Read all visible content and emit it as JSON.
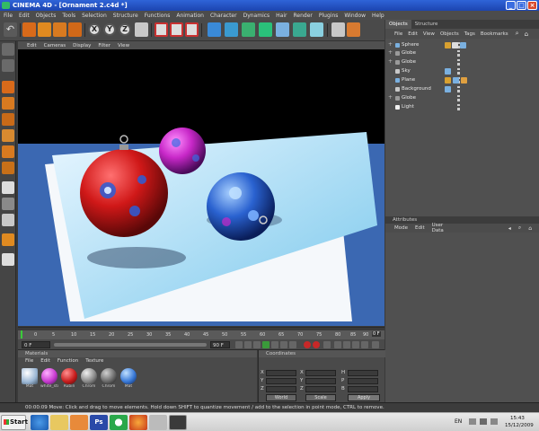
{
  "window": {
    "title": "CINEMA 4D - [Ornament 2.c4d *]"
  },
  "menu": [
    "File",
    "Edit",
    "Objects",
    "Tools",
    "Selection",
    "Structure",
    "Functions",
    "Animation",
    "Character",
    "Dynamics",
    "Hair",
    "Render",
    "Plugins",
    "Window",
    "Help"
  ],
  "toolbar": {
    "axis_x": "X",
    "axis_y": "Y",
    "axis_z": "Z"
  },
  "viewport": {
    "menu": [
      "Edit",
      "Cameras",
      "Display",
      "Filter",
      "View"
    ]
  },
  "timeline": {
    "ticks": [
      "0",
      "5",
      "10",
      "15",
      "20",
      "25",
      "30",
      "35",
      "40",
      "45",
      "50",
      "55",
      "60",
      "65",
      "70",
      "75",
      "80",
      "85",
      "90"
    ],
    "frame_readout": "0 F",
    "start_field": "0 F",
    "end_field": "90 F"
  },
  "materials": {
    "title": "Materials",
    "menu": [
      "File",
      "Edit",
      "Function",
      "Texture"
    ],
    "items": [
      {
        "label": "Mat",
        "color": "#9ab6d4"
      },
      {
        "label": "white_sti",
        "color": "#c83bd0"
      },
      {
        "label": "Rubin",
        "color": "#c81e1e"
      },
      {
        "label": "Chrom",
        "color": "#8a8a8a"
      },
      {
        "label": "Chrom",
        "color": "#6a6a6a"
      },
      {
        "label": "Mat",
        "color": "#3a7ad8"
      }
    ]
  },
  "coordinates": {
    "title": "Coordinates",
    "col_labels": [
      "X",
      "Y",
      "Z"
    ],
    "mid_labels": [
      "X",
      "Y",
      "Z"
    ],
    "right_labels": [
      "H",
      "P",
      "B"
    ],
    "mode_world": "World",
    "mode_scale": "Scale",
    "apply": "Apply"
  },
  "objects_panel": {
    "tabs": [
      "Objects",
      "Structure"
    ],
    "menu": [
      "File",
      "Edit",
      "View",
      "Objects",
      "Tags",
      "Bookmarks"
    ],
    "rows": [
      {
        "name": "Sphere",
        "icon": "#7ab0e0"
      },
      {
        "name": "Globe",
        "icon": "#9a9a9a"
      },
      {
        "name": "Globe",
        "icon": "#9a9a9a"
      },
      {
        "name": "Sky",
        "icon": "#c8c8c8"
      },
      {
        "name": "Plane",
        "icon": "#7ab0e0"
      },
      {
        "name": "Background",
        "icon": "#c8c8c8"
      },
      {
        "name": "Globe",
        "icon": "#9a9a9a"
      },
      {
        "name": "Light",
        "icon": "#f0f0f0"
      }
    ]
  },
  "attributes_panel": {
    "title": "Attributes",
    "menu": [
      "Mode",
      "Edit",
      "User Data"
    ]
  },
  "statusbar": {
    "text": "00:00:09   Move: Click and drag to move elements. Hold down SHIFT to quantize movement / add to the selection in point mode, CTRL to remove."
  },
  "taskbar": {
    "start_label": "Start",
    "lang": "EN",
    "time": "15:43",
    "date": "15/12/2009"
  },
  "colors": {
    "viewport_bg": "#3b68b2",
    "accent": "#2f64d8"
  }
}
